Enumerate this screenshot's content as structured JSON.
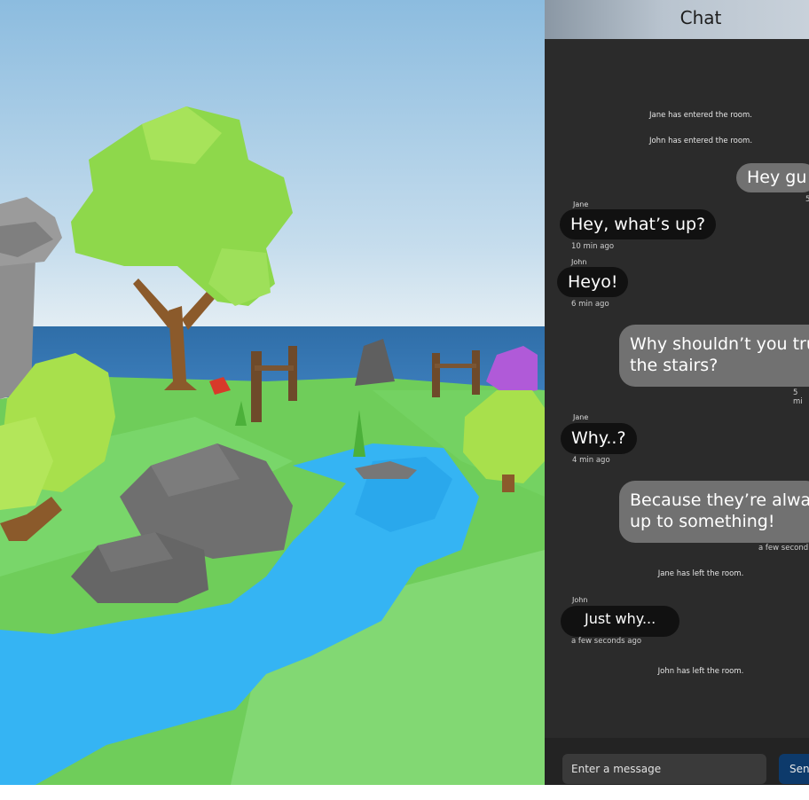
{
  "chat": {
    "title": "Chat",
    "system_messages": [
      "Jane has entered the room.",
      "John has entered the room.",
      "Jane has left the room.",
      "John has left the room."
    ],
    "messages": [
      {
        "sender": "",
        "text": "Hey gu",
        "time": "5",
        "outgoing": true
      },
      {
        "sender": "Jane",
        "text": "Hey, what’s up?",
        "time": "10 min ago",
        "outgoing": false
      },
      {
        "sender": "John",
        "text": "Heyo!",
        "time": "6 min ago",
        "outgoing": false
      },
      {
        "sender": "",
        "line1": "Why shouldn’t you tru",
        "line2": "the stairs?",
        "time": "5 mi",
        "outgoing": true
      },
      {
        "sender": "Jane",
        "text": "Why..?",
        "time": "4 min ago",
        "outgoing": false
      },
      {
        "sender": "",
        "line1": "Because they’re alwa",
        "line2": "up to something!",
        "time": "a few second",
        "outgoing": true
      },
      {
        "sender": "John",
        "text": "Just why...",
        "time": "a few seconds ago",
        "outgoing": false
      }
    ],
    "input": {
      "placeholder": "Enter a message",
      "value": ""
    },
    "send_label": "Sen"
  },
  "colors": {
    "panel_bg": "#2b2b2b",
    "incoming_bubble": "#111111",
    "outgoing_bubble": "#717171",
    "send_button": "#0d3a6b",
    "header_gradient_start": "#8a97a4",
    "header_gradient_end": "#c8d1da"
  }
}
